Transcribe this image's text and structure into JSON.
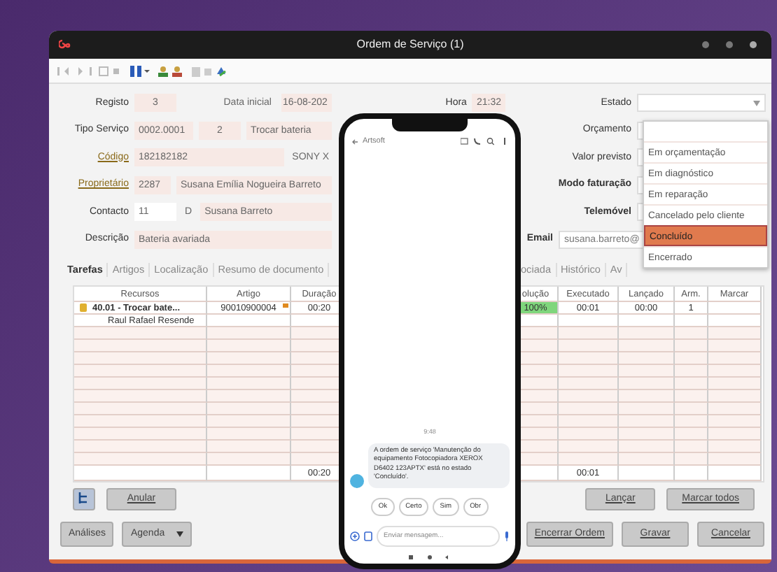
{
  "window": {
    "title": "Ordem de Serviço (1)"
  },
  "form": {
    "left_rows": [
      {
        "label": "Registo",
        "link": false,
        "fields": [
          {
            "kind": "num",
            "text": "3"
          },
          {
            "kind": "label",
            "text": "Data inicial"
          },
          {
            "kind": "date",
            "text": "16-08-202"
          }
        ]
      },
      {
        "label": "Tipo Serviço",
        "link": false,
        "fields": [
          {
            "kind": "code",
            "text": "0002.0001"
          },
          {
            "kind": "num",
            "text": "2"
          },
          {
            "kind": "wide",
            "text": "Trocar bateria"
          }
        ]
      },
      {
        "label": "Código",
        "link": true,
        "fields": [
          {
            "kind": "wide",
            "text": "182182182"
          },
          {
            "kind": "plain",
            "text": "SONY X"
          }
        ]
      },
      {
        "label": "Proprietário",
        "link": true,
        "fields": [
          {
            "kind": "short",
            "text": "2287"
          },
          {
            "kind": "wide",
            "text": "Susana Emília Nogueira Barreto"
          }
        ]
      },
      {
        "label": "Contacto",
        "link": false,
        "fields": [
          {
            "kind": "white",
            "text": "11"
          },
          {
            "kind": "plain",
            "text": "D"
          },
          {
            "kind": "wide",
            "text": "Susana Barreto"
          }
        ]
      },
      {
        "label": "Descrição",
        "link": false,
        "fields": [
          {
            "kind": "wide",
            "text": "Bateria avariada"
          }
        ]
      }
    ],
    "hora": {
      "label": "Hora",
      "value": "21:32"
    },
    "right_rows": [
      {
        "label": "Estado",
        "bold": false,
        "kind": "select"
      },
      {
        "label": "Orçamento",
        "bold": false,
        "kind": "field"
      },
      {
        "label": "Valor previsto",
        "bold": false,
        "kind": "field"
      },
      {
        "label": "Modo faturação",
        "bold": true,
        "kind": "field"
      },
      {
        "label": "Telemóvel",
        "bold": true,
        "kind": "field"
      },
      {
        "label": "Email",
        "bold": true,
        "kind": "email",
        "value": "susana.barreto@"
      }
    ]
  },
  "estado_dropdown": {
    "options": [
      {
        "label": "Em orçamentação",
        "selected": false
      },
      {
        "label": "Em diagnóstico",
        "selected": false
      },
      {
        "label": "Em reparação",
        "selected": false
      },
      {
        "label": "Cancelado pelo cliente",
        "selected": false
      },
      {
        "label": "Concluído",
        "selected": true
      },
      {
        "label": "Encerrado",
        "selected": false
      }
    ]
  },
  "tabs": [
    {
      "label": "Tarefas",
      "selected": true
    },
    {
      "label": "Artigos",
      "selected": false
    },
    {
      "label": "Localização",
      "selected": false
    },
    {
      "label": "Resumo de documento",
      "selected": false
    },
    {
      "label": "ociada",
      "selected": false
    },
    {
      "label": "Histórico",
      "selected": false
    },
    {
      "label": "Av",
      "selected": false
    }
  ],
  "table": {
    "columns": [
      "Recursos",
      "Artigo",
      "Duração",
      null,
      "olução",
      "Executado",
      "Lançado",
      "Arm.",
      "Marcar"
    ],
    "rows": [
      {
        "kind": "task",
        "cells": [
          "40.01 - Trocar bate...",
          "90010900004",
          "00:20",
          null,
          "100%",
          "00:01",
          "00:00",
          "1",
          null
        ],
        "level": 1
      },
      {
        "kind": "resource",
        "cells": [
          "Raul Rafael Resende"
        ]
      }
    ],
    "totals": {
      "duration": "00:20",
      "executed": "00:01"
    }
  },
  "task_buttons": {
    "left": [
      "Anular"
    ],
    "right": [
      "Lançar",
      "Marcar todos"
    ]
  },
  "footer": {
    "left": [
      {
        "label": "Análises",
        "dropdown": false
      },
      {
        "label": "Agenda",
        "dropdown": true
      }
    ],
    "right": [
      "Encerrar Ordem",
      "Gravar",
      "Cancelar"
    ]
  },
  "phone": {
    "contact": "Artsoft",
    "time": "9:48",
    "message": "A ordem de serviço 'Manutenção do equipamento Fotocopiadora XEROX D6402 123APTX' está no estado 'Concluído'.",
    "quick_replies": [
      "Ok",
      "Certo",
      "Sim",
      "Obr"
    ],
    "input_placeholder": "Enviar mensagem..."
  }
}
